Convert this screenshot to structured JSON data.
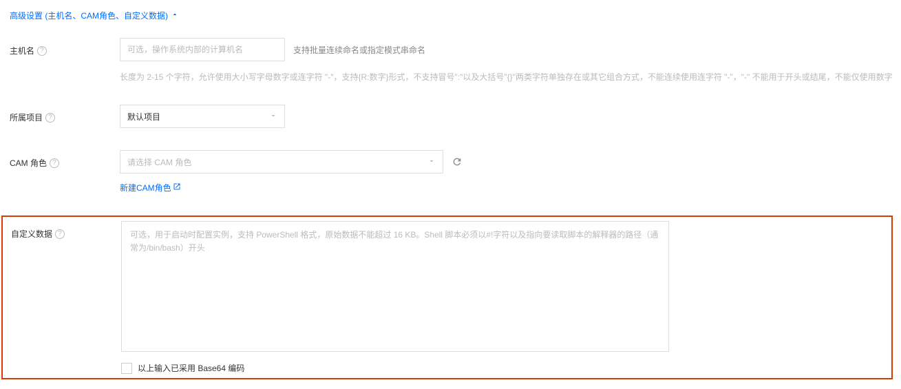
{
  "collapse": {
    "title": "高级设置 (主机名、CAM角色、自定义数据)"
  },
  "hostname": {
    "label": "主机名",
    "placeholder": "可选，操作系统内部的计算机名",
    "hint_right": "支持批量连续命名或指定模式串命名",
    "hint_below": "长度为 2-15 个字符，允许使用大小写字母数字或连字符 \"-\"，支持{R:数字}形式，不支持冒号\":\"以及大括号\"{}\"两类字符单独存在或其它组合方式，不能连续使用连字符 \"-\"，\"-\" 不能用于开头或结尾，不能仅使用数字"
  },
  "project": {
    "label": "所属项目",
    "selected": "默认项目"
  },
  "cam": {
    "label": "CAM 角色",
    "placeholder": "请选择 CAM 角色",
    "new_link": "新建CAM角色"
  },
  "userdata": {
    "label": "自定义数据",
    "placeholder": "可选，用于启动时配置实例，支持 PowerShell 格式，原始数据不能超过 16 KB。Shell 脚本必须以#!字符以及指向要读取脚本的解释器的路径（通常为/bin/bash）开头",
    "base64_label": "以上输入已采用 Base64 编码"
  }
}
